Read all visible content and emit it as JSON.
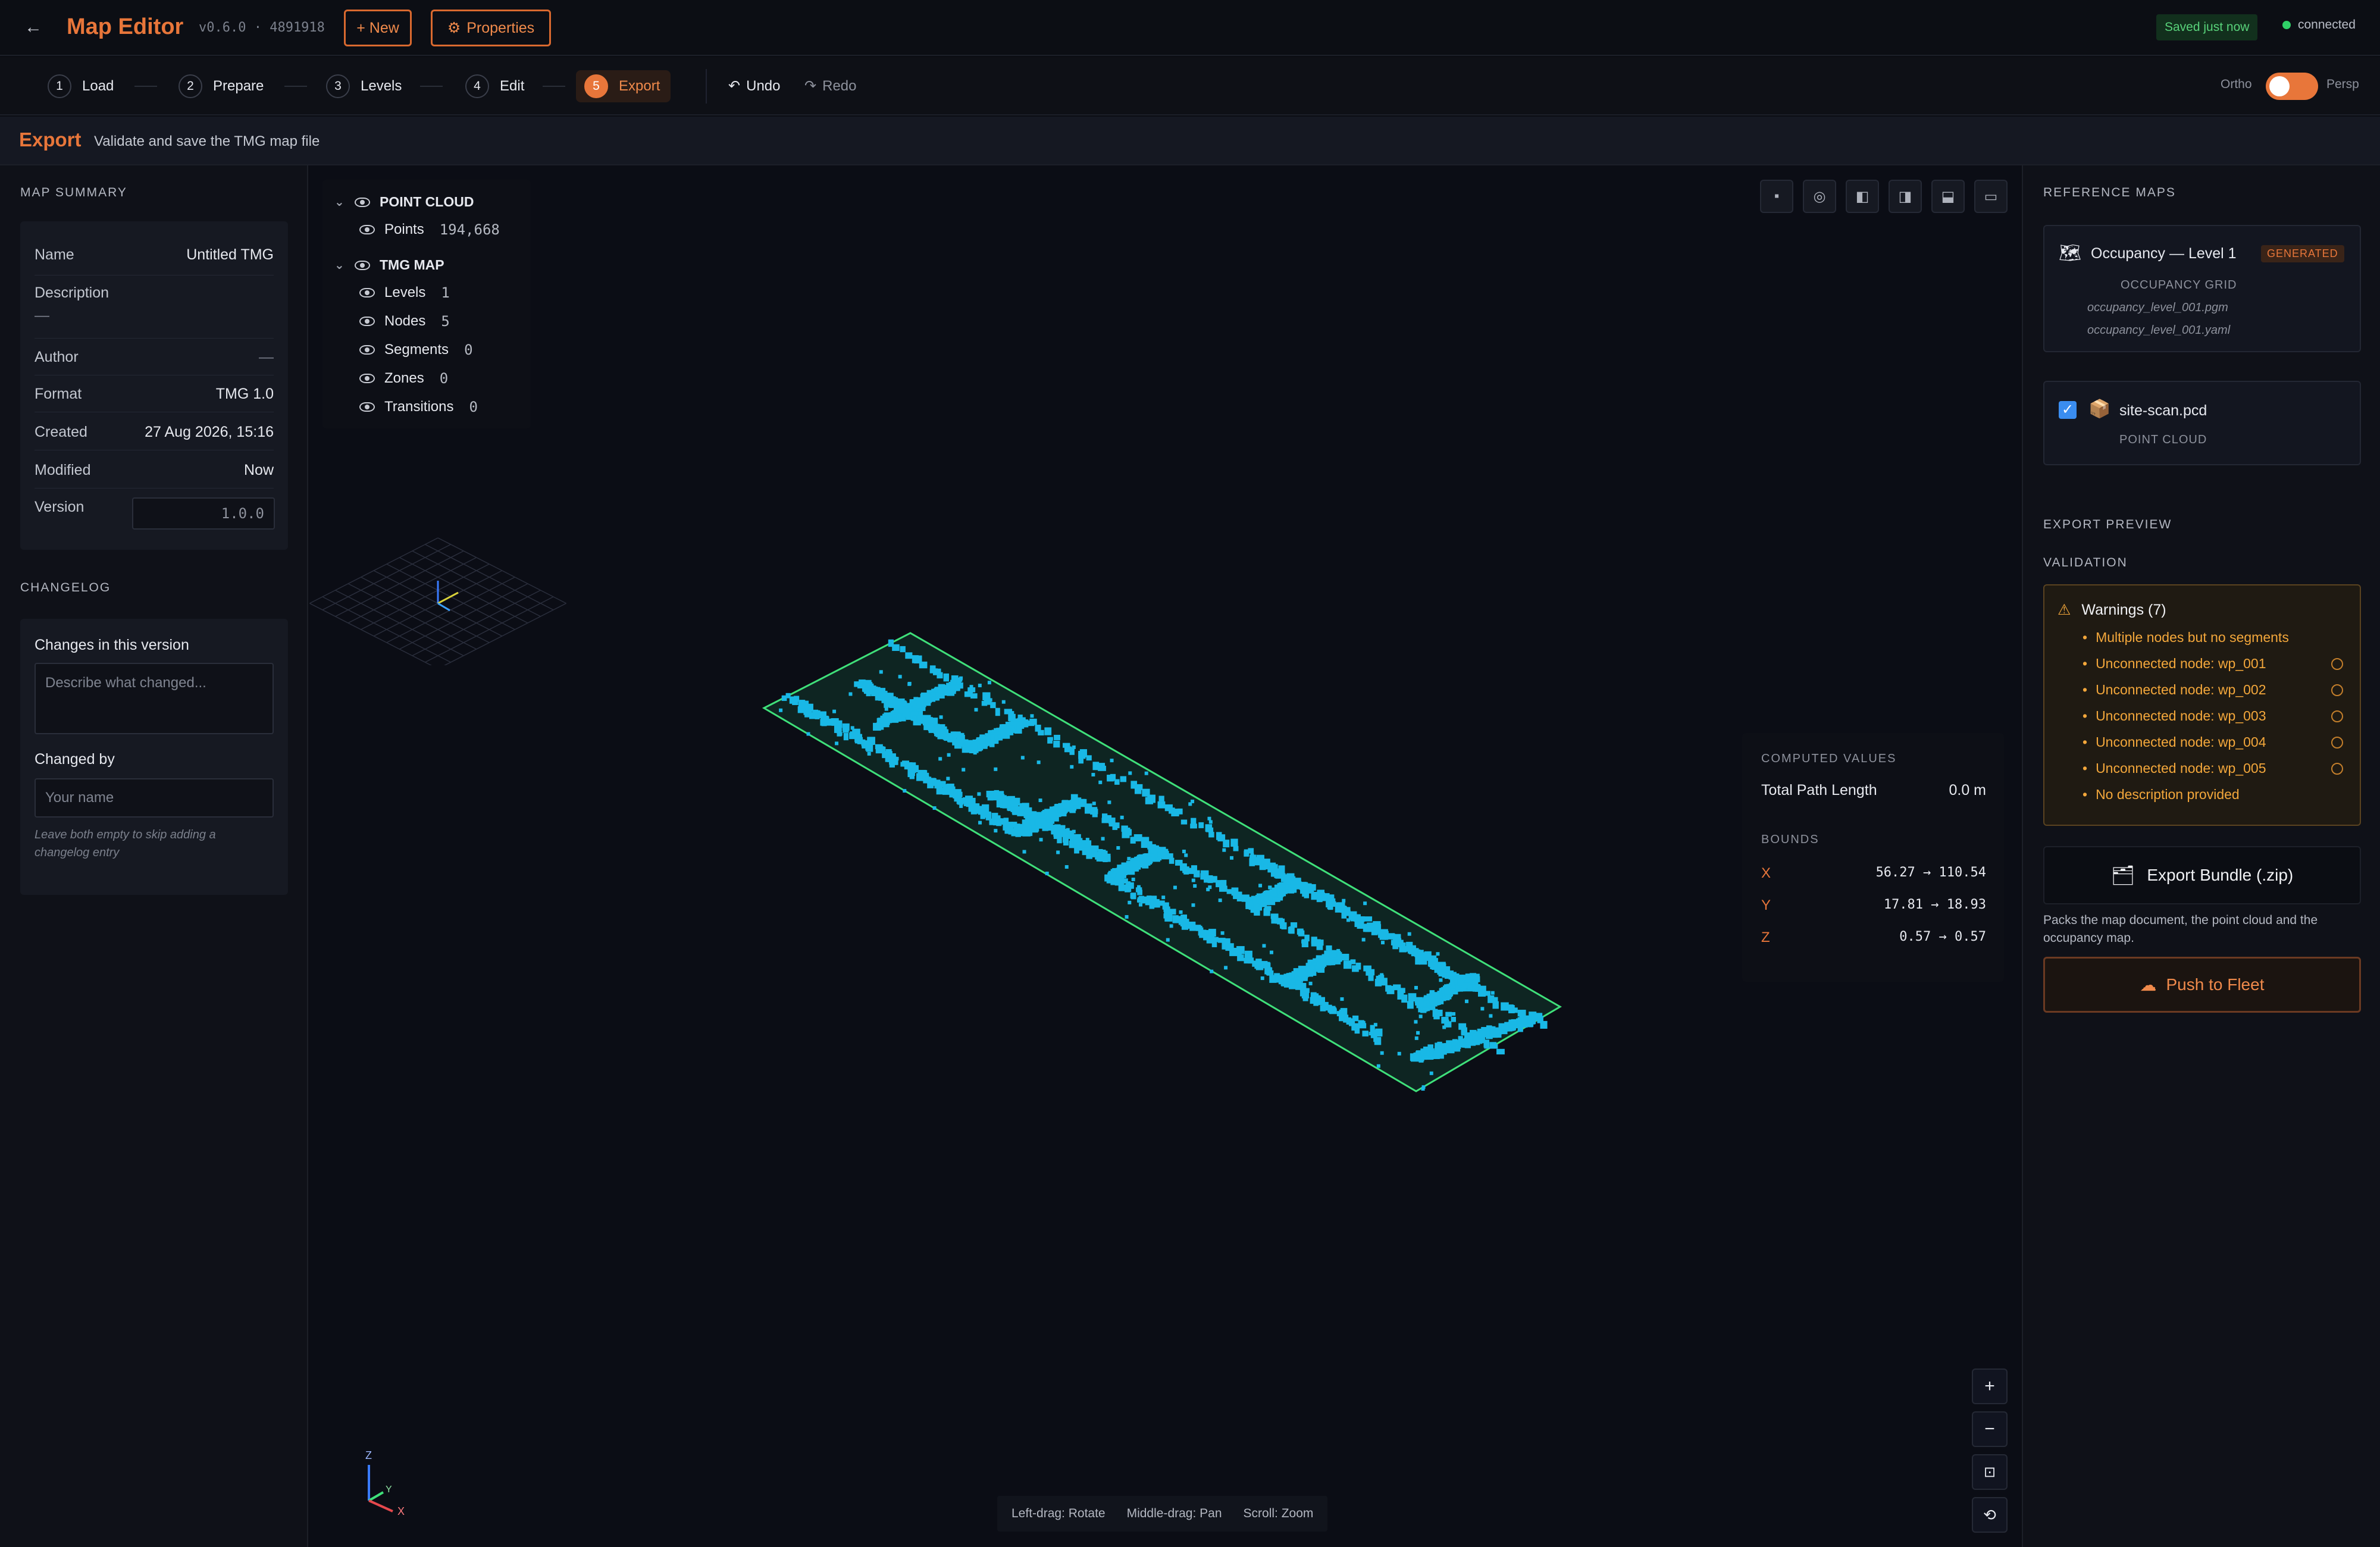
{
  "app": {
    "title": "Map Editor",
    "version": "v0.6.0 · 4891918",
    "new_label": "+ New",
    "properties_label": "Properties",
    "saved_label": "Saved just now",
    "connection_label": "connected"
  },
  "steps": [
    {
      "num": "1",
      "label": "Load"
    },
    {
      "num": "2",
      "label": "Prepare"
    },
    {
      "num": "3",
      "label": "Levels"
    },
    {
      "num": "4",
      "label": "Edit"
    },
    {
      "num": "5",
      "label": "Export"
    }
  ],
  "history": {
    "undo_label": "Undo",
    "redo_label": "Redo"
  },
  "view_toggle": {
    "left_label": "Ortho",
    "right_label": "Persp",
    "state": "persp"
  },
  "section": {
    "title": "Export",
    "description": "Validate and save the TMG map file"
  },
  "map_summary": {
    "title": "MAP SUMMARY",
    "name_label": "Name",
    "name_value": "Untitled TMG",
    "description_label": "Description",
    "description_value": "—",
    "author_label": "Author",
    "author_value": "—",
    "format_label": "Format",
    "format_value": "TMG 1.0",
    "created_label": "Created",
    "created_value": "27 Aug 2026, 15:16",
    "modified_label": "Modified",
    "modified_value": "Now",
    "version_label": "Version",
    "version_value": "1.0.0"
  },
  "changelog": {
    "title": "CHANGELOG",
    "changes_label": "Changes in this version",
    "changes_placeholder": "Describe what changed...",
    "changed_by_label": "Changed by",
    "changed_by_placeholder": "Your name",
    "hint": "Leave both empty to skip adding a changelog entry"
  },
  "layers": {
    "point_cloud_title": "POINT CLOUD",
    "points_label": "Points",
    "points_value": "194,668",
    "tmg_title": "TMG MAP",
    "items": [
      {
        "label": "Levels",
        "value": "1"
      },
      {
        "label": "Nodes",
        "value": "5"
      },
      {
        "label": "Segments",
        "value": "0"
      },
      {
        "label": "Zones",
        "value": "0"
      },
      {
        "label": "Transitions",
        "value": "0"
      }
    ]
  },
  "computed": {
    "title": "COMPUTED VALUES",
    "path_label": "Total Path Length",
    "path_value": "0.0 m",
    "bounds_title": "BOUNDS",
    "bounds": [
      {
        "axis": "X",
        "value": "56.27 → 110.54",
        "color": "#e8763a"
      },
      {
        "axis": "Y",
        "value": "17.81 → 18.93",
        "color": "#e8763a"
      },
      {
        "axis": "Z",
        "value": "0.57 → 0.57",
        "color": "#e8763a"
      }
    ]
  },
  "axes_gizmo": {
    "z": "Z",
    "y": "Y",
    "x": "X"
  },
  "hints": {
    "rotate": "Left-drag: Rotate",
    "pan": "Middle-drag: Pan",
    "zoom": "Scroll: Zoom"
  },
  "reference_maps": {
    "title": "REFERENCE MAPS",
    "occupancy": {
      "name": "Occupancy — Level 1",
      "badge": "GENERATED",
      "type": "OCCUPANCY GRID",
      "file1": "occupancy_level_001.pgm",
      "file2": "occupancy_level_001.yaml"
    },
    "pointcloud": {
      "name": "site-scan.pcd",
      "type": "POINT CLOUD",
      "checked": true
    }
  },
  "export_preview": {
    "title": "EXPORT PREVIEW",
    "validation_title": "VALIDATION",
    "warnings_title": "Warnings (7)",
    "warnings": [
      "Multiple nodes but no segments",
      "Unconnected node: wp_001",
      "Unconnected node: wp_002",
      "Unconnected node: wp_003",
      "Unconnected node: wp_004",
      "Unconnected node: wp_005",
      "No description provided"
    ],
    "export_label": "Export Bundle (.zip)",
    "export_desc": "Packs the map document, the point cloud and the occupancy map.",
    "push_label": "Push to Fleet"
  },
  "colors": {
    "accent": "#e8763a",
    "cloud": "#19b8e6",
    "bounds": "#3fe07a",
    "warning": "#f3a73b"
  }
}
